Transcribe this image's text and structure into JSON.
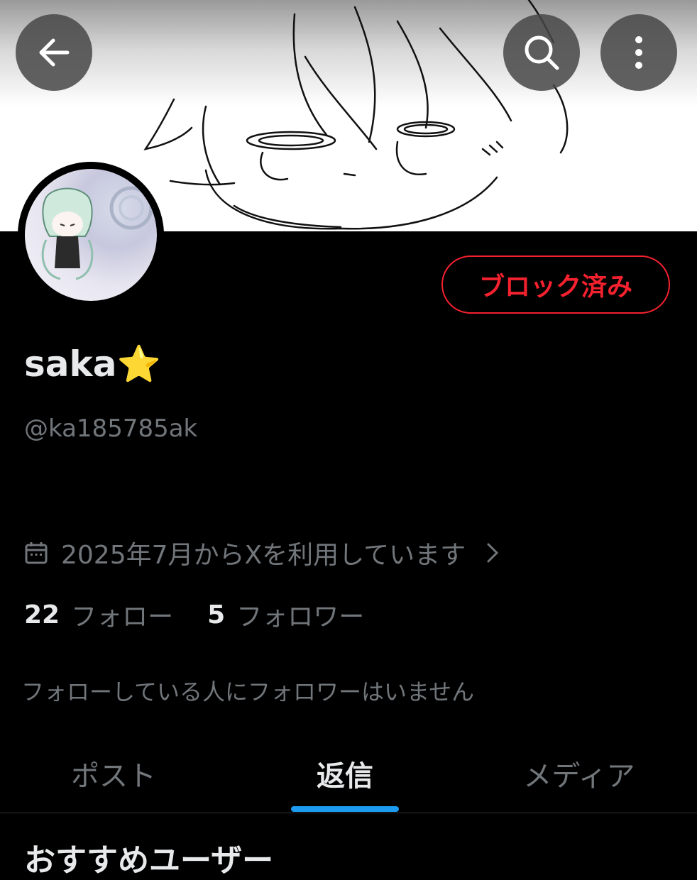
{
  "header": {
    "back_icon": "arrow-left-icon",
    "search_icon": "search-icon",
    "more_icon": "more-vertical-icon"
  },
  "profile": {
    "name": "saka⭐",
    "handle": "@ka185785ak",
    "block_button_label": "ブロック済み",
    "joined_text": "2025年7月からXを利用しています",
    "following_count": "22",
    "following_label": "フォロー",
    "followers_count": "5",
    "followers_label": "フォロワー",
    "followers_you_know": "フォローしている人にフォロワーはいません"
  },
  "tabs": [
    {
      "label": "ポスト",
      "active": false
    },
    {
      "label": "返信",
      "active": true
    },
    {
      "label": "メディア",
      "active": false
    }
  ],
  "section": {
    "title": "おすすめユーザー"
  },
  "colors": {
    "accent": "#1d9bf0",
    "block_red": "#f4212e",
    "text_primary": "#e7e9ea",
    "text_secondary": "#71767b",
    "background": "#000000"
  }
}
